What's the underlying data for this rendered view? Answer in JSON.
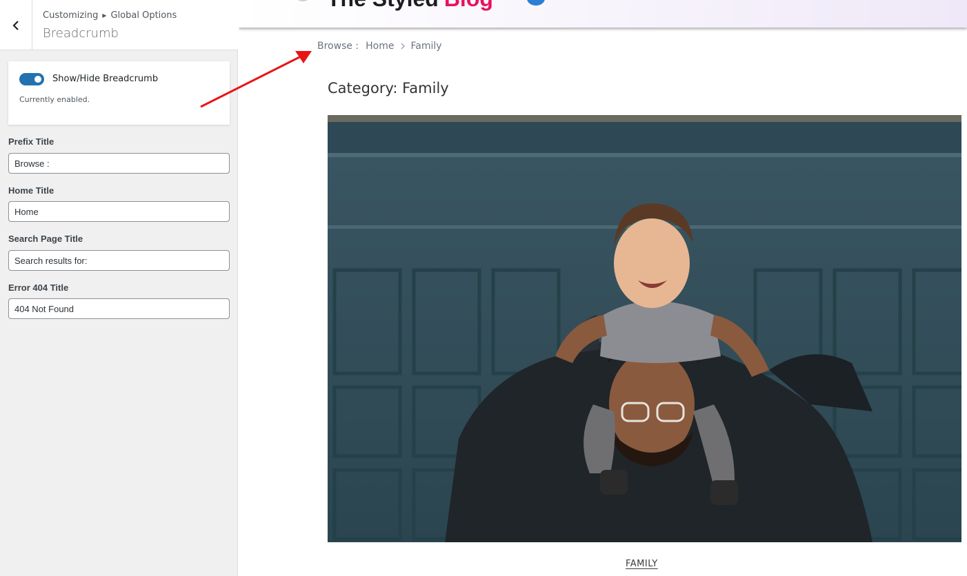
{
  "customizer": {
    "breadcrumb_root": "Customizing",
    "breadcrumb_parent": "Global Options",
    "section_title": "Breadcrumb",
    "toggle": {
      "label": "Show/Hide Breadcrumb",
      "description": "Currently enabled.",
      "enabled": true
    },
    "fields": [
      {
        "label": "Prefix Title",
        "value": "Browse :"
      },
      {
        "label": "Home Title",
        "value": "Home"
      },
      {
        "label": "Search Page Title",
        "value": "Search results for:"
      },
      {
        "label": "Error 404 Title",
        "value": "404 Not Found"
      }
    ]
  },
  "preview": {
    "site_title": "The Styled",
    "site_title_accent": "Blog",
    "breadcrumb": {
      "prefix": "Browse :",
      "home": "Home",
      "current": "Family"
    },
    "page_heading": "Category: Family",
    "hero_image": "father-carrying-baby-on-shoulders",
    "category_tag": "FAMILY"
  },
  "colors": {
    "toggle_on": "#2271b1",
    "site_accent": "#e8125c",
    "annotation_arrow": "#e81515"
  }
}
